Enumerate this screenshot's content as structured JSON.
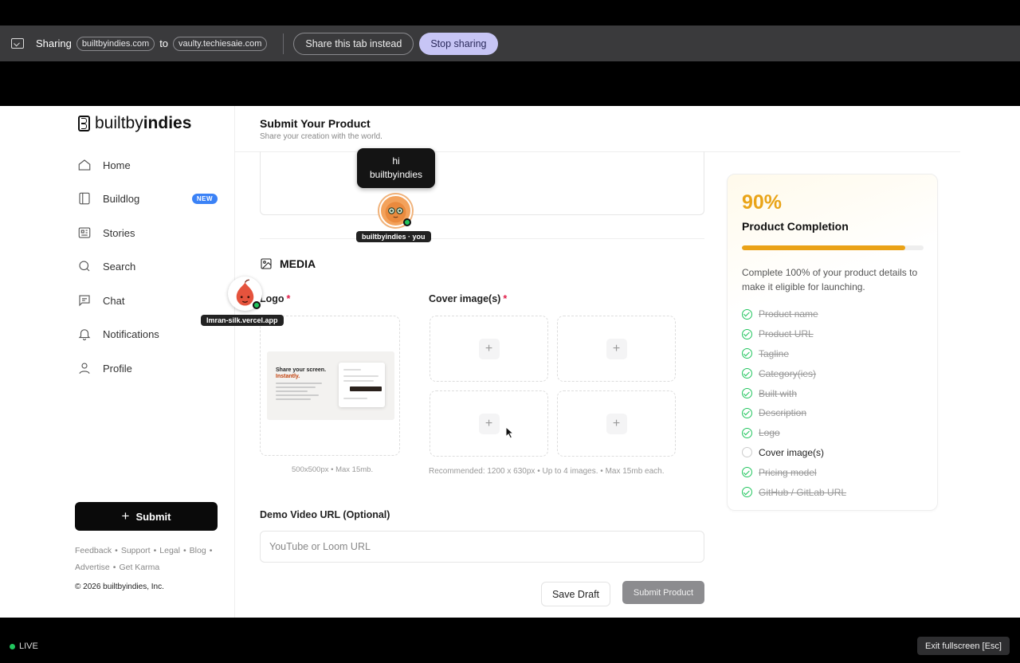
{
  "share_bar": {
    "label": "Sharing",
    "from_domain": "builtbyindies.com",
    "to_word": "to",
    "to_domain": "vaulty.techiesaie.com",
    "share_tab_label": "Share this tab instead",
    "stop_label": "Stop sharing"
  },
  "brand": {
    "prefix": "builtby",
    "suffix": "indies"
  },
  "sidebar": {
    "items": [
      {
        "label": "Home",
        "icon": "home-icon"
      },
      {
        "label": "Buildlog",
        "icon": "book-icon",
        "badge": "NEW"
      },
      {
        "label": "Stories",
        "icon": "newspaper-icon"
      },
      {
        "label": "Search",
        "icon": "search-icon"
      },
      {
        "label": "Chat",
        "icon": "chat-icon"
      },
      {
        "label": "Notifications",
        "icon": "bell-icon"
      },
      {
        "label": "Profile",
        "icon": "user-icon"
      }
    ],
    "submit_label": "Submit",
    "footer_links": [
      "Feedback",
      "Support",
      "Legal",
      "Blog",
      "Advertise",
      "Get Karma"
    ],
    "copyright": "© 2026 builtbyindies, Inc."
  },
  "main": {
    "title": "Submit Your Product",
    "subtitle": "Share your creation with the world.",
    "media_heading": "MEDIA",
    "logo_label": "Logo",
    "logo_hint": "500x500px • Max 15mb.",
    "cover_label": "Cover image(s)",
    "cover_hint": "Recommended: 1200 x 630px • Up to 4 images. • Max 15mb each.",
    "required_mark": "*",
    "plus": "+",
    "logo_preview": {
      "line1": "Share your screen.",
      "line2": "Instantly."
    },
    "video_label": "Demo Video URL (Optional)",
    "video_placeholder": "YouTube or Loom URL",
    "video_value": "",
    "save_draft_label": "Save Draft",
    "submit_product_label": "Submit Product"
  },
  "completion": {
    "percent_label": "90%",
    "percent_value": 0.9,
    "title": "Product Completion",
    "description": "Complete 100% of your product details to make it eligible for launching.",
    "checklist": [
      {
        "label": "Product name",
        "done": true
      },
      {
        "label": "Product URL",
        "done": true
      },
      {
        "label": "Tagline",
        "done": true
      },
      {
        "label": "Category(ies)",
        "done": true
      },
      {
        "label": "Built with",
        "done": true
      },
      {
        "label": "Description",
        "done": true
      },
      {
        "label": "Logo",
        "done": true
      },
      {
        "label": "Cover image(s)",
        "done": false
      },
      {
        "label": "Pricing model",
        "done": true
      },
      {
        "label": "GitHub / GitLab URL",
        "done": true
      }
    ]
  },
  "presence": {
    "tooltip_line1": "hi",
    "tooltip_line2": "builtbyindies",
    "self_tag": "builtbyindies · you",
    "peer_tag": "Imran-silk.vercel.app"
  },
  "bottom": {
    "live_label": "LIVE",
    "exit_label": "Exit fullscreen [Esc]"
  },
  "colors": {
    "accent": "#eaa217",
    "success": "#22c55e",
    "badge": "#3b82f6",
    "required": "#e11d48"
  }
}
